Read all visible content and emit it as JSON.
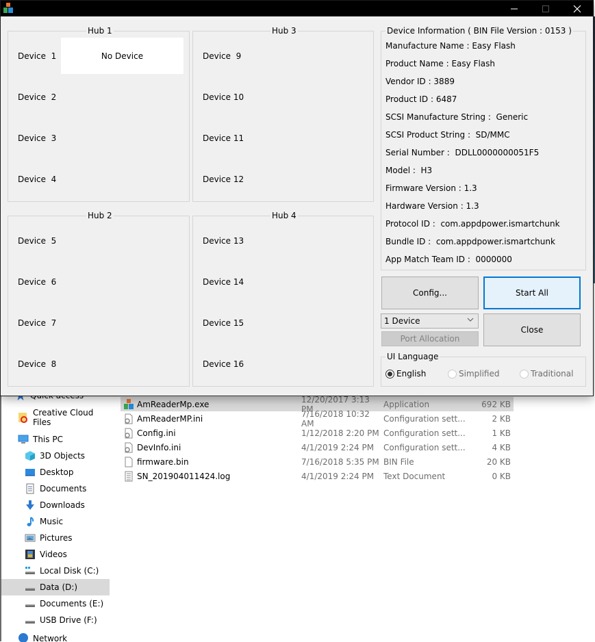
{
  "window": {
    "title": "",
    "controls": {
      "minimize": "—",
      "maximize": "☐",
      "close": "✕"
    }
  },
  "hubs": [
    {
      "title": "Hub 1",
      "devices": [
        {
          "label": "Device  1",
          "status": "No Device"
        },
        {
          "label": "Device  2"
        },
        {
          "label": "Device  3"
        },
        {
          "label": "Device  4"
        }
      ]
    },
    {
      "title": "Hub 2",
      "devices": [
        {
          "label": "Device  5"
        },
        {
          "label": "Device  6"
        },
        {
          "label": "Device  7"
        },
        {
          "label": "Device  8"
        }
      ]
    },
    {
      "title": "Hub 3",
      "devices": [
        {
          "label": "Device  9"
        },
        {
          "label": "Device 10"
        },
        {
          "label": "Device 11"
        },
        {
          "label": "Device 12"
        }
      ]
    },
    {
      "title": "Hub 4",
      "devices": [
        {
          "label": "Device 13"
        },
        {
          "label": "Device 14"
        },
        {
          "label": "Device 15"
        },
        {
          "label": "Device 16"
        }
      ]
    }
  ],
  "device_info": {
    "title": "Device Information ( BIN File Version : 0153 )",
    "lines": [
      "Manufacture Name : Easy Flash",
      "Product Name : Easy Flash",
      "Vendor ID : 3889",
      "Product ID : 6487",
      "SCSI Manufacture String :  Generic",
      "SCSI Product String :  SD/MMC",
      "Serial Number :  DDLL0000000051F5",
      "Model :  H3",
      "Firmware Version : 1.3",
      "Hardware Version : 1.3",
      "Protocol ID :  com.appdpower.ismartchunk",
      "Bundle ID :  com.appdpower.ismartchunk",
      "App Match Team ID :  0000000"
    ]
  },
  "buttons": {
    "config": "Config...",
    "start_all": "Start All",
    "close": "Close",
    "port_allocation": "Port Allocation"
  },
  "device_count_select": {
    "value": "1 Device"
  },
  "ui_language": {
    "title": "UI Language",
    "options": [
      {
        "label": "English",
        "selected": true,
        "enabled": true
      },
      {
        "label": "Simplified",
        "selected": false,
        "enabled": false
      },
      {
        "label": "Traditional",
        "selected": false,
        "enabled": false
      }
    ]
  },
  "explorer": {
    "nav_items": [
      {
        "label": "Quick access",
        "icon": "star-icon"
      },
      {
        "label": "Creative Cloud Files",
        "icon": "creative-cloud-icon"
      },
      {
        "label": "This PC",
        "icon": "computer-icon"
      },
      {
        "label": "3D Objects",
        "icon": "cube-icon"
      },
      {
        "label": "Desktop",
        "icon": "desktop-icon"
      },
      {
        "label": "Documents",
        "icon": "document-icon"
      },
      {
        "label": "Downloads",
        "icon": "download-icon"
      },
      {
        "label": "Music",
        "icon": "music-icon"
      },
      {
        "label": "Pictures",
        "icon": "pictures-icon"
      },
      {
        "label": "Videos",
        "icon": "videos-icon"
      },
      {
        "label": "Local Disk (C:)",
        "icon": "drive-icon"
      },
      {
        "label": "Data (D:)",
        "icon": "drive-icon",
        "selected": true
      },
      {
        "label": "Documents (E:)",
        "icon": "drive-icon"
      },
      {
        "label": "USB Drive (F:)",
        "icon": "drive-icon"
      },
      {
        "label": "Network",
        "icon": "network-icon"
      }
    ],
    "files": [
      {
        "name": "AmReaderMp.exe",
        "date": "12/20/2017 3:13 PM",
        "type": "Application",
        "size": "692 KB",
        "icon": "app-icon",
        "selected": true
      },
      {
        "name": "AmReaderMP.ini",
        "date": "7/16/2018 10:32 AM",
        "type": "Configuration sett...",
        "size": "2 KB",
        "icon": "settings-file-icon"
      },
      {
        "name": "Config.ini",
        "date": "1/12/2018 2:20 PM",
        "type": "Configuration sett...",
        "size": "1 KB",
        "icon": "settings-file-icon"
      },
      {
        "name": "DevInfo.ini",
        "date": "4/1/2019 2:24 PM",
        "type": "Configuration sett...",
        "size": "4 KB",
        "icon": "settings-file-icon"
      },
      {
        "name": "firmware.bin",
        "date": "7/16/2018 5:35 PM",
        "type": "BIN File",
        "size": "20 KB",
        "icon": "blank-file-icon"
      },
      {
        "name": "SN_201904011424.log",
        "date": "4/1/2019 2:24 PM",
        "type": "Text Document",
        "size": "0 KB",
        "icon": "text-file-icon"
      }
    ]
  },
  "colors": {
    "accent": "#0078d7",
    "window_bg": "#f0f0f0",
    "titlebar": "#000000",
    "selection": "#d9d9d9"
  }
}
